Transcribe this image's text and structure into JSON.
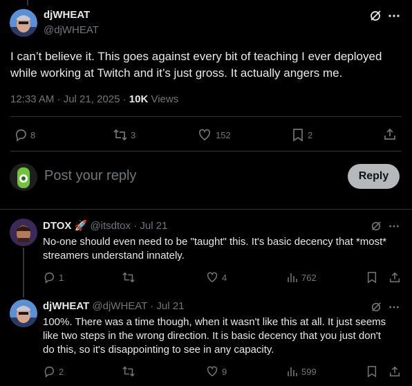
{
  "main_post": {
    "display_name": "djWHEAT",
    "handle": "@djWHEAT",
    "text_line1": "I can’t believe it. This goes against every bit of teaching I ever deployed",
    "text_line2": "while working at Twitch and it’s just gross. It actually angers me.",
    "timestamp": "12:33 AM · Jul 21, 2025 · ",
    "views_count": "10K",
    "views_label": " Views",
    "stats": {
      "replies": "8",
      "reposts": "3",
      "likes": "152",
      "bookmarks": "2"
    }
  },
  "composer": {
    "placeholder": "Post your reply",
    "button_label": "Reply"
  },
  "replies": [
    {
      "display_name": "DTOX",
      "emoji": "🚀",
      "handle": "@itsdtox",
      "time": "· Jul 21",
      "text_line1": "No-one should even need to be \"taught\" this. It's basic decency that *most*",
      "text_line2": "streamers understand innately.",
      "stats": {
        "replies": "1",
        "reposts": "",
        "likes": "4",
        "views": "762"
      }
    },
    {
      "display_name": "djWHEAT",
      "handle": "@djWHEAT",
      "time": "· Jul 21",
      "text_line1": "100%. There was a time though, when it wasn't like this at all. It just seems",
      "text_line2": "like two steps in the wrong direction. It is basic decency that you just don't",
      "text_line3": "do this, so it's disappointing to see in any capacity.",
      "stats": {
        "replies": "2",
        "reposts": "",
        "likes": "9",
        "views": "599"
      }
    }
  ],
  "colors": {
    "background": "#000000",
    "text": "#e7e9ea",
    "muted": "#71767b",
    "divider": "#2f3336",
    "reply_button": "#b6b9bc"
  }
}
